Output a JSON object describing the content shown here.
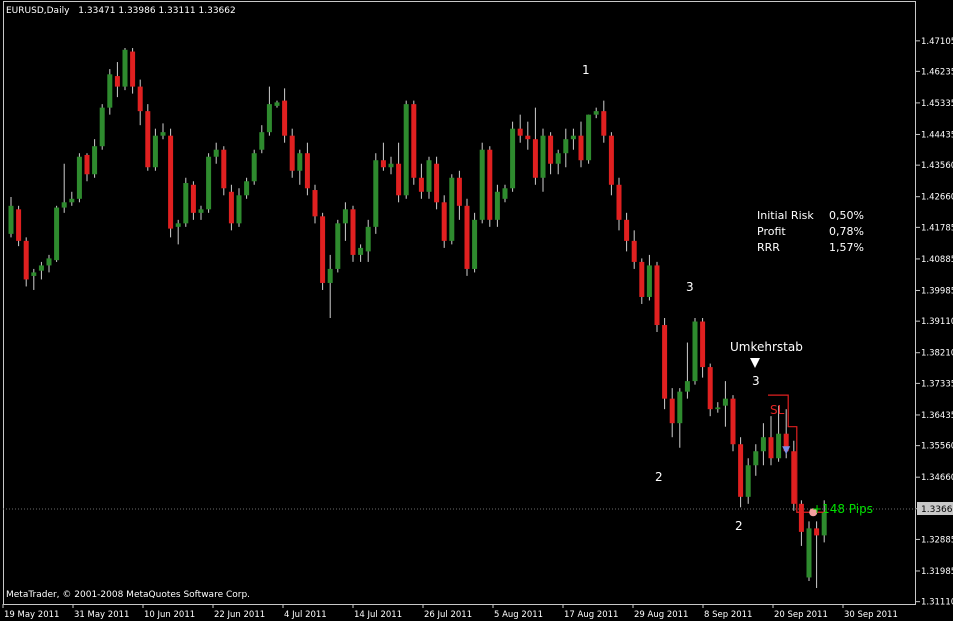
{
  "header": {
    "symbol": "EURUSD,Daily",
    "ohlc": "1.33471 1.33986 1.33111 1.33662"
  },
  "footer": {
    "copyright": "MetaTrader, © 2001-2008 MetaQuotes Software Corp."
  },
  "current_price_label": "1.33662",
  "colors": {
    "background": "#000000",
    "bull": "#2e8b2e",
    "bear": "#e02020",
    "frame": "#c8c8c8",
    "text": "#ffffff",
    "grid": "#3a3a3a",
    "profit": "#00e000",
    "stop": "#e02020",
    "marker": "#7a8ee6"
  },
  "chart_data": {
    "type": "candlestick",
    "title": "EURUSD,Daily",
    "ylim": [
      1.311,
      1.475
    ],
    "y_ticks": [
      "1.47105",
      "1.46235",
      "1.45335",
      "1.44435",
      "1.43560",
      "1.42660",
      "1.41785",
      "1.40885",
      "1.39985",
      "1.39110",
      "1.38210",
      "1.37335",
      "1.36435",
      "1.35560",
      "1.34660",
      "1.33760",
      "1.32885",
      "1.31985",
      "1.31110"
    ],
    "x_labels": [
      "19 May 2011",
      "31 May 2011",
      "10 Jun 2011",
      "22 Jun 2011",
      "4 Jul 2011",
      "14 Jul 2011",
      "26 Jul 2011",
      "5 Aug 2011",
      "17 Aug 2011",
      "29 Aug 2011",
      "8 Sep 2011",
      "20 Sep 2011",
      "30 Sep 2011"
    ],
    "candles": [
      [
        1.416,
        1.4265,
        1.415,
        1.424
      ],
      [
        1.423,
        1.424,
        1.4125,
        1.414
      ],
      [
        1.414,
        1.415,
        1.401,
        1.403
      ],
      [
        1.404,
        1.406,
        1.4,
        1.405
      ],
      [
        1.4055,
        1.408,
        1.403,
        1.407
      ],
      [
        1.407,
        1.41,
        1.405,
        1.409
      ],
      [
        1.4085,
        1.424,
        1.408,
        1.4235
      ],
      [
        1.4235,
        1.436,
        1.422,
        1.425
      ],
      [
        1.425,
        1.428,
        1.424,
        1.426
      ],
      [
        1.426,
        1.439,
        1.425,
        1.438
      ],
      [
        1.4385,
        1.439,
        1.431,
        1.433
      ],
      [
        1.433,
        1.443,
        1.432,
        1.441
      ],
      [
        1.441,
        1.453,
        1.44,
        1.452
      ],
      [
        1.452,
        1.463,
        1.45,
        1.4615
      ],
      [
        1.461,
        1.465,
        1.455,
        1.458
      ],
      [
        1.458,
        1.469,
        1.457,
        1.4685
      ],
      [
        1.468,
        1.469,
        1.456,
        1.458
      ],
      [
        1.458,
        1.46,
        1.447,
        1.451
      ],
      [
        1.451,
        1.453,
        1.434,
        1.435
      ],
      [
        1.435,
        1.446,
        1.434,
        1.444
      ],
      [
        1.444,
        1.4475,
        1.443,
        1.445
      ],
      [
        1.444,
        1.446,
        1.415,
        1.4175
      ],
      [
        1.418,
        1.42,
        1.413,
        1.419
      ],
      [
        1.419,
        1.432,
        1.418,
        1.4305
      ],
      [
        1.43,
        1.431,
        1.42,
        1.422
      ],
      [
        1.422,
        1.424,
        1.42,
        1.423
      ],
      [
        1.423,
        1.439,
        1.422,
        1.438
      ],
      [
        1.438,
        1.442,
        1.436,
        1.44
      ],
      [
        1.44,
        1.441,
        1.427,
        1.429
      ],
      [
        1.428,
        1.43,
        1.417,
        1.419
      ],
      [
        1.419,
        1.429,
        1.418,
        1.427
      ],
      [
        1.427,
        1.432,
        1.426,
        1.431
      ],
      [
        1.431,
        1.44,
        1.43,
        1.439
      ],
      [
        1.44,
        1.447,
        1.439,
        1.445
      ],
      [
        1.445,
        1.458,
        1.444,
        1.453
      ],
      [
        1.4525,
        1.454,
        1.452,
        1.4535
      ],
      [
        1.454,
        1.4575,
        1.442,
        1.444
      ],
      [
        1.444,
        1.446,
        1.432,
        1.434
      ],
      [
        1.434,
        1.44,
        1.43,
        1.439
      ],
      [
        1.439,
        1.442,
        1.427,
        1.429
      ],
      [
        1.4285,
        1.43,
        1.419,
        1.421
      ],
      [
        1.421,
        1.422,
        1.4,
        1.402
      ],
      [
        1.402,
        1.41,
        1.392,
        1.406
      ],
      [
        1.406,
        1.42,
        1.405,
        1.419
      ],
      [
        1.419,
        1.425,
        1.414,
        1.423
      ],
      [
        1.423,
        1.424,
        1.408,
        1.41
      ],
      [
        1.41,
        1.413,
        1.408,
        1.412
      ],
      [
        1.411,
        1.42,
        1.408,
        1.418
      ],
      [
        1.418,
        1.439,
        1.416,
        1.437
      ],
      [
        1.437,
        1.442,
        1.434,
        1.435
      ],
      [
        1.435,
        1.438,
        1.433,
        1.436
      ],
      [
        1.436,
        1.442,
        1.425,
        1.427
      ],
      [
        1.427,
        1.454,
        1.426,
        1.453
      ],
      [
        1.453,
        1.454,
        1.43,
        1.432
      ],
      [
        1.432,
        1.436,
        1.426,
        1.428
      ],
      [
        1.428,
        1.438,
        1.426,
        1.437
      ],
      [
        1.436,
        1.438,
        1.423,
        1.425
      ],
      [
        1.425,
        1.427,
        1.412,
        1.414
      ],
      [
        1.414,
        1.433,
        1.413,
        1.432
      ],
      [
        1.432,
        1.434,
        1.42,
        1.424
      ],
      [
        1.424,
        1.426,
        1.404,
        1.406
      ],
      [
        1.406,
        1.422,
        1.405,
        1.42
      ],
      [
        1.42,
        1.442,
        1.419,
        1.44
      ],
      [
        1.44,
        1.441,
        1.418,
        1.42
      ],
      [
        1.42,
        1.43,
        1.418,
        1.428
      ],
      [
        1.426,
        1.43,
        1.425,
        1.429
      ],
      [
        1.429,
        1.448,
        1.428,
        1.446
      ],
      [
        1.446,
        1.45,
        1.442,
        1.444
      ],
      [
        1.444,
        1.448,
        1.44,
        1.443
      ],
      [
        1.443,
        1.452,
        1.43,
        1.432
      ],
      [
        1.432,
        1.446,
        1.428,
        1.444
      ],
      [
        1.444,
        1.445,
        1.433,
        1.436
      ],
      [
        1.436,
        1.44,
        1.433,
        1.439
      ],
      [
        1.439,
        1.446,
        1.435,
        1.443
      ],
      [
        1.443,
        1.446,
        1.44,
        1.444
      ],
      [
        1.444,
        1.448,
        1.435,
        1.437
      ],
      [
        1.437,
        1.45,
        1.436,
        1.45
      ],
      [
        1.45,
        1.452,
        1.449,
        1.451
      ],
      [
        1.451,
        1.454,
        1.442,
        1.444
      ],
      [
        1.444,
        1.445,
        1.427,
        1.43
      ],
      [
        1.43,
        1.432,
        1.417,
        1.42
      ],
      [
        1.42,
        1.422,
        1.411,
        1.414
      ],
      [
        1.414,
        1.417,
        1.406,
        1.408
      ],
      [
        1.408,
        1.409,
        1.396,
        1.398
      ],
      [
        1.398,
        1.41,
        1.397,
        1.407
      ],
      [
        1.407,
        1.408,
        1.388,
        1.39
      ],
      [
        1.39,
        1.392,
        1.366,
        1.369
      ],
      [
        1.369,
        1.372,
        1.358,
        1.362
      ],
      [
        1.362,
        1.372,
        1.355,
        1.371
      ],
      [
        1.371,
        1.385,
        1.369,
        1.374
      ],
      [
        1.374,
        1.392,
        1.373,
        1.391
      ],
      [
        1.391,
        1.392,
        1.375,
        1.378
      ],
      [
        1.378,
        1.379,
        1.364,
        1.366
      ],
      [
        1.366,
        1.368,
        1.365,
        1.3665
      ],
      [
        1.367,
        1.374,
        1.361,
        1.369
      ],
      [
        1.369,
        1.37,
        1.354,
        1.356
      ],
      [
        1.356,
        1.358,
        1.338,
        1.341
      ],
      [
        1.341,
        1.352,
        1.339,
        1.35
      ],
      [
        1.35,
        1.356,
        1.347,
        1.354
      ],
      [
        1.354,
        1.362,
        1.35,
        1.358
      ],
      [
        1.358,
        1.364,
        1.35,
        1.352
      ],
      [
        1.352,
        1.367,
        1.351,
        1.359
      ],
      [
        1.359,
        1.366,
        1.352,
        1.354
      ],
      [
        1.354,
        1.357,
        1.337,
        1.339
      ],
      [
        1.339,
        1.34,
        1.327,
        1.331
      ],
      [
        1.318,
        1.334,
        1.317,
        1.332
      ],
      [
        1.332,
        1.334,
        1.315,
        1.33
      ],
      [
        1.33,
        1.34,
        1.328,
        1.3366
      ]
    ],
    "annotations": [
      {
        "text": "1",
        "x": 4.0,
        "price": 1.4586
      },
      {
        "text": "3",
        "x": 37.0,
        "price": 1.3957
      },
      {
        "text": "2",
        "x": 20.5,
        "price": 1.3457
      },
      {
        "text": "Umkehrstab",
        "x": 25.5,
        "price": 1.3847
      },
      {
        "text": "3",
        "x": 26.5,
        "price": 1.3737
      },
      {
        "text": "2",
        "x": 31.5,
        "price": 1.3316
      },
      {
        "text": "SL",
        "x": 28.5,
        "price": 1.3645,
        "color": "#e02020"
      },
      {
        "text": "+148 Pips",
        "x": 36.5,
        "price": 1.3366,
        "color": "#00e000"
      }
    ],
    "risk_box": [
      {
        "label": "Initial Risk",
        "value": "0,50%"
      },
      {
        "label": "Profit",
        "value": "0,78%"
      },
      {
        "label": "RRR",
        "value": "1,57%"
      }
    ],
    "entry_price": 1.354,
    "stop_price": 1.37,
    "exit_price": 1.3366
  }
}
